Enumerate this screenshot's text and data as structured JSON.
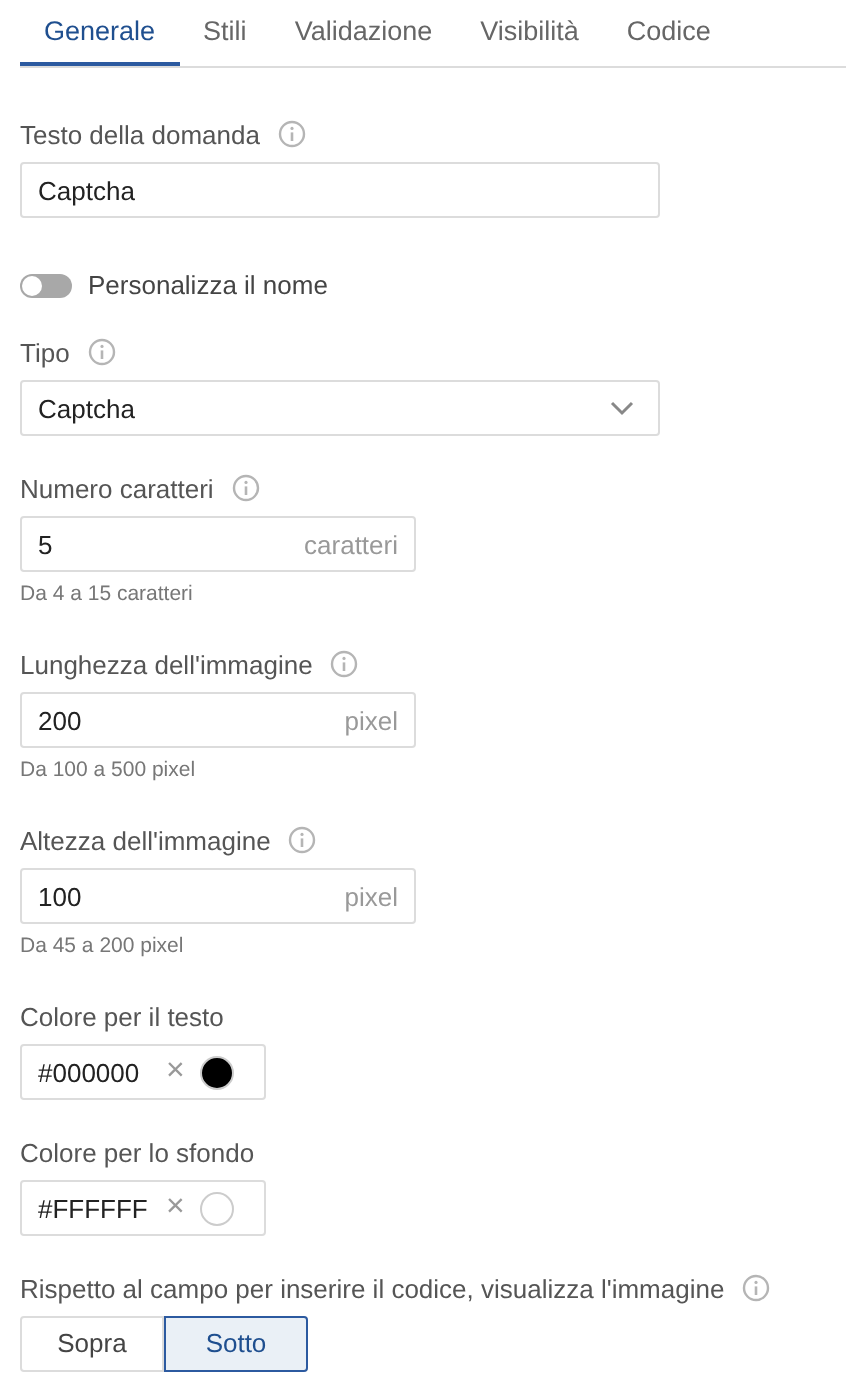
{
  "tabs": [
    {
      "label": "Generale",
      "selected": true
    },
    {
      "label": "Stili",
      "selected": false
    },
    {
      "label": "Validazione",
      "selected": false
    },
    {
      "label": "Visibilità",
      "selected": false
    },
    {
      "label": "Codice",
      "selected": false
    }
  ],
  "fields": [
    {
      "kind": "text",
      "label": "Testo della domanda",
      "info": true,
      "value": "Captcha"
    },
    {
      "kind": "toggle",
      "label": "Personalizza il nome",
      "on": false
    },
    {
      "kind": "select",
      "label": "Tipo",
      "info": true,
      "value": "Captcha"
    },
    {
      "kind": "number",
      "label": "Numero caratteri",
      "info": true,
      "value": "5",
      "unit": "caratteri",
      "hint": "Da 4 a 15 caratteri"
    },
    {
      "kind": "number",
      "label": "Lunghezza dell'immagine",
      "info": true,
      "value": "200",
      "unit": "pixel",
      "hint": "Da 100 a 500 pixel"
    },
    {
      "kind": "number",
      "label": "Altezza dell'immagine",
      "info": true,
      "value": "100",
      "unit": "pixel",
      "hint": "Da 45 a 200 pixel"
    },
    {
      "kind": "color",
      "label": "Colore per il testo",
      "value": "#000000",
      "clear": "×",
      "color": "#000000"
    },
    {
      "kind": "color",
      "label": "Colore per lo sfondo",
      "value": "#FFFFFF",
      "clear": "×",
      "color": "#ffffff"
    },
    {
      "kind": "segmented",
      "label": "Rispetto al campo per inserire il codice, visualizza l'immagine",
      "info": true,
      "options": [
        {
          "label": "Sopra",
          "selected": false
        },
        {
          "label": "Sotto",
          "selected": true
        }
      ]
    }
  ]
}
